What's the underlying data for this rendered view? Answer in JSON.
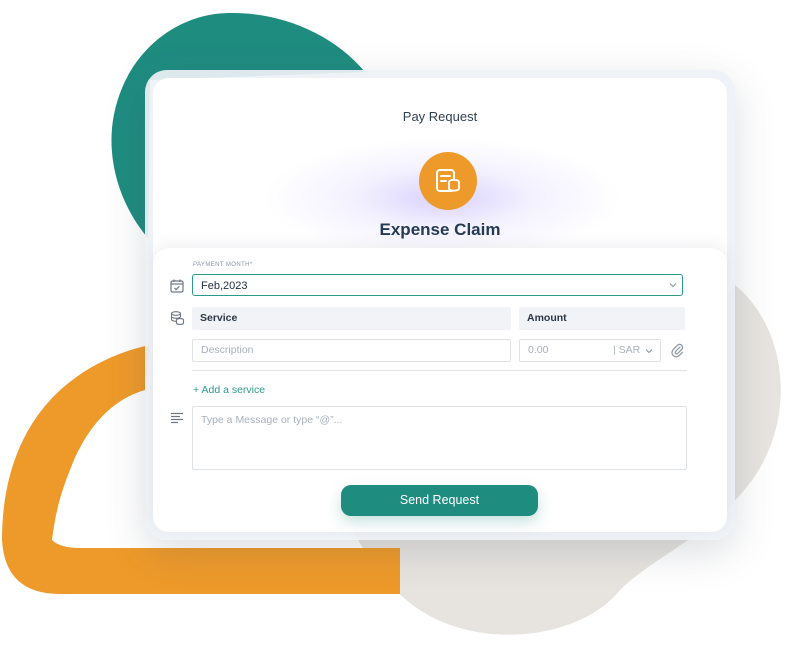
{
  "header": {
    "title": "Pay Request",
    "heading": "Expense Claim",
    "icon": "coins-document-icon"
  },
  "form": {
    "payment_month": {
      "label": "PAYMENT MONTH*",
      "value": "Feb,2023",
      "icon": "calendar-check-icon"
    },
    "services_table": {
      "icon": "coins-stack-icon",
      "headers": [
        "Service",
        "Amount"
      ],
      "row": {
        "description_placeholder": "Description",
        "amount_placeholder": "0.00",
        "currency": "| SAR",
        "attach_icon": "paperclip-icon"
      }
    },
    "add_service_label": "+ Add a service",
    "message": {
      "icon": "text-lines-icon",
      "placeholder": "Type a Message or type “@”..."
    },
    "submit_label": "Send Request"
  },
  "colors": {
    "teal": "#1f8c80",
    "orange": "#ee9a2a",
    "accent_border": "#2b9a8c",
    "blob_gray": "#e7e4df"
  }
}
